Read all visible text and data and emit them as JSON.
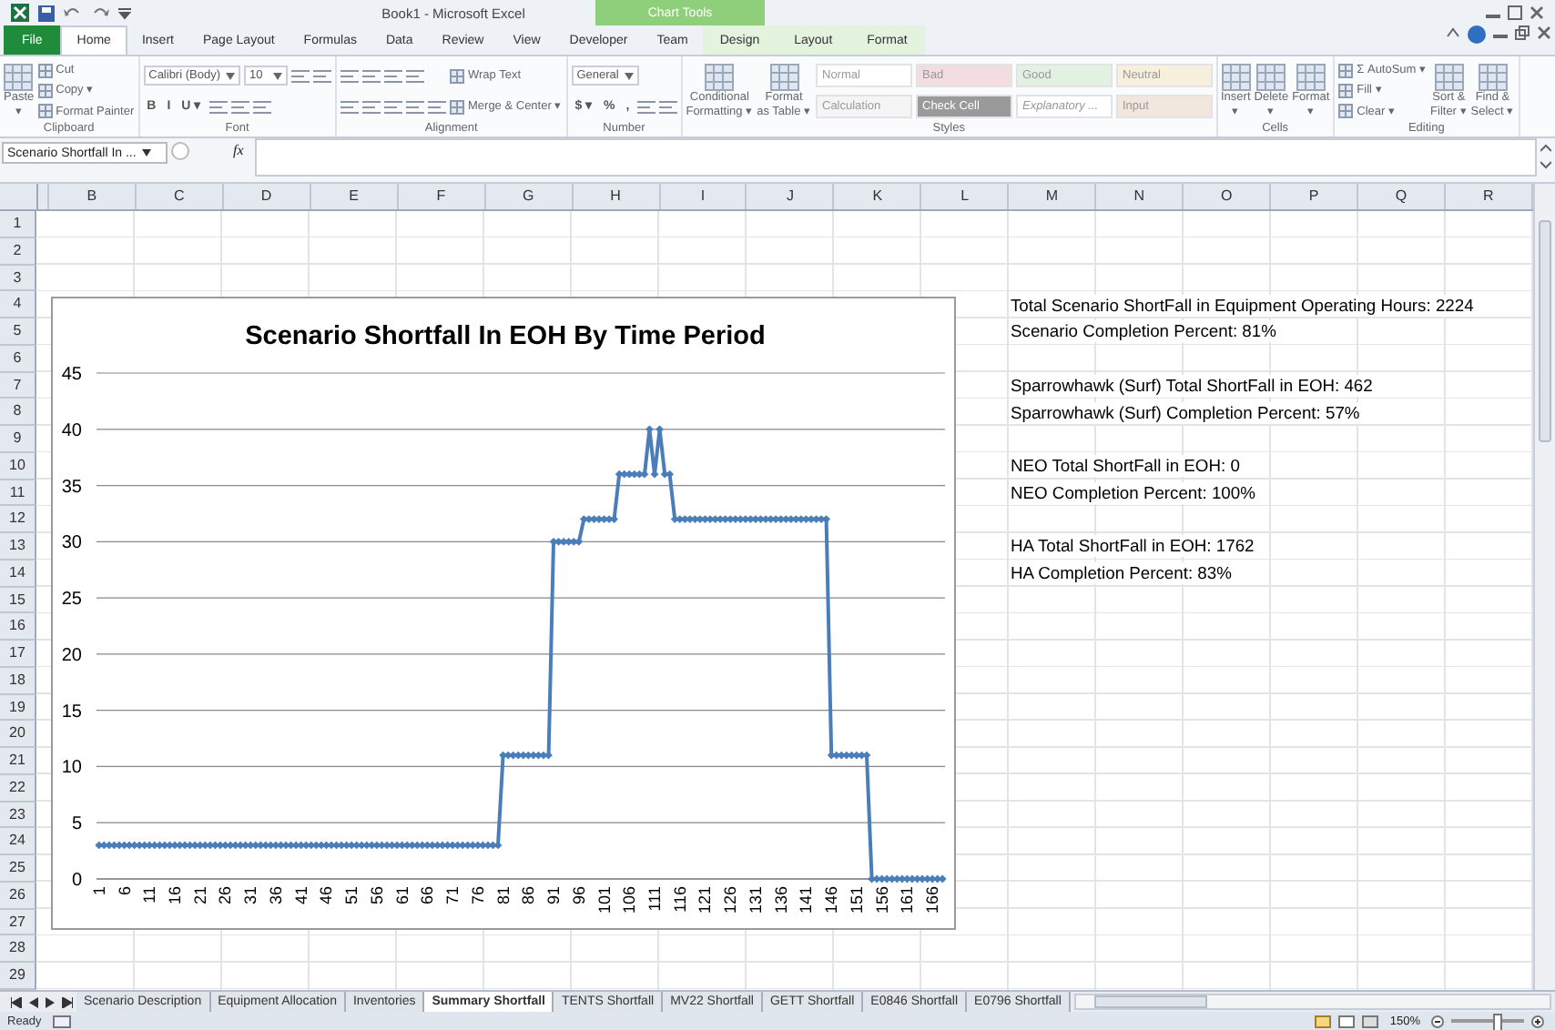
{
  "title_bar": {
    "title": "Book1 - Microsoft Excel",
    "context_group": "Chart Tools"
  },
  "tabs": [
    {
      "label": "File",
      "kind": "file",
      "selected": false
    },
    {
      "label": "Home",
      "kind": "main",
      "selected": true
    },
    {
      "label": "Insert",
      "kind": "main",
      "selected": false
    },
    {
      "label": "Page Layout",
      "kind": "main",
      "selected": false
    },
    {
      "label": "Formulas",
      "kind": "main",
      "selected": false
    },
    {
      "label": "Data",
      "kind": "main",
      "selected": false
    },
    {
      "label": "Review",
      "kind": "main",
      "selected": false
    },
    {
      "label": "View",
      "kind": "main",
      "selected": false
    },
    {
      "label": "Developer",
      "kind": "main",
      "selected": false
    },
    {
      "label": "Team",
      "kind": "main",
      "selected": false
    },
    {
      "label": "Design",
      "kind": "context",
      "selected": false
    },
    {
      "label": "Layout",
      "kind": "context",
      "selected": false
    },
    {
      "label": "Format",
      "kind": "context",
      "selected": false
    }
  ],
  "ribbon": {
    "groups": [
      {
        "label": "Clipboard",
        "columns": [
          [
            [
              {
                "kind": "large",
                "lines": [
                  "Paste",
                  "▾"
                ]
              }
            ]
          ],
          [
            [
              {
                "kind": "small",
                "label": "Cut"
              }
            ],
            [
              {
                "kind": "small",
                "label": "Copy ▾"
              }
            ],
            [
              {
                "kind": "small",
                "label": "Format Painter"
              }
            ]
          ]
        ]
      },
      {
        "label": "Font",
        "columns": [
          [
            [
              {
                "kind": "combo",
                "label": "Calibri (Body)"
              },
              {
                "kind": "combo",
                "label": "10"
              },
              {
                "kind": "icon"
              },
              {
                "kind": "icon"
              }
            ],
            [
              {
                "kind": "text",
                "label": "B"
              },
              {
                "kind": "text",
                "label": "I"
              },
              {
                "kind": "text",
                "label": "U ▾"
              },
              {
                "kind": "icon"
              },
              {
                "kind": "icon"
              },
              {
                "kind": "icon"
              }
            ]
          ]
        ]
      },
      {
        "label": "Alignment",
        "columns": [
          [
            [
              {
                "kind": "icon"
              },
              {
                "kind": "icon"
              },
              {
                "kind": "icon"
              },
              {
                "kind": "icon"
              }
            ],
            [
              {
                "kind": "icon"
              },
              {
                "kind": "icon"
              },
              {
                "kind": "icon"
              },
              {
                "kind": "icon"
              },
              {
                "kind": "icon"
              }
            ]
          ],
          [
            [
              {
                "kind": "small",
                "label": "Wrap Text"
              }
            ],
            [
              {
                "kind": "small",
                "label": "Merge & Center ▾"
              }
            ]
          ]
        ]
      },
      {
        "label": "Number",
        "columns": [
          [
            [
              {
                "kind": "combo",
                "label": "General"
              }
            ],
            [
              {
                "kind": "text",
                "label": "$ ▾"
              },
              {
                "kind": "text",
                "label": "%"
              },
              {
                "kind": "text",
                "label": ","
              },
              {
                "kind": "icon"
              },
              {
                "kind": "icon"
              }
            ]
          ]
        ]
      },
      {
        "label": "Styles",
        "columns": [
          [
            [
              {
                "kind": "large",
                "lines": [
                  "Conditional",
                  "Formatting ▾"
                ]
              }
            ]
          ],
          [
            [
              {
                "kind": "large",
                "lines": [
                  "Format",
                  "as Table ▾"
                ]
              }
            ]
          ],
          [
            [
              {
                "kind": "style",
                "label": "Normal",
                "color": "#ffffff",
                "italic": false
              },
              {
                "kind": "style",
                "label": "Bad",
                "color": "#f4dde0",
                "italic": false
              },
              {
                "kind": "style",
                "label": "Good",
                "color": "#e3f1e3",
                "italic": false
              },
              {
                "kind": "style",
                "label": "Neutral",
                "color": "#f7f0dc",
                "italic": false
              }
            ],
            [
              {
                "kind": "style",
                "label": "Calculation",
                "color": "#f5f5f5",
                "italic": false
              },
              {
                "kind": "style",
                "label": "Check Cell",
                "color": "#9a9a9a",
                "italic": false
              },
              {
                "kind": "style",
                "label": "Explanatory ...",
                "color": "#ffffff",
                "italic": true
              },
              {
                "kind": "style",
                "label": "Input",
                "color": "#f3e6dc",
                "italic": false
              }
            ]
          ]
        ]
      },
      {
        "label": "Cells",
        "columns": [
          [
            [
              {
                "kind": "large",
                "lines": [
                  "Insert",
                  "▾"
                ]
              }
            ]
          ],
          [
            [
              {
                "kind": "large",
                "lines": [
                  "Delete",
                  "▾"
                ]
              }
            ]
          ],
          [
            [
              {
                "kind": "large",
                "lines": [
                  "Format",
                  "▾"
                ]
              }
            ]
          ]
        ]
      },
      {
        "label": "Editing",
        "columns": [
          [
            [
              {
                "kind": "small",
                "label": "Σ AutoSum ▾"
              }
            ],
            [
              {
                "kind": "small",
                "label": "Fill ▾"
              }
            ],
            [
              {
                "kind": "small",
                "label": "Clear ▾"
              }
            ]
          ],
          [
            [
              {
                "kind": "large",
                "lines": [
                  "Sort &",
                  "Filter ▾"
                ]
              }
            ]
          ],
          [
            [
              {
                "kind": "large",
                "lines": [
                  "Find &",
                  "Select ▾"
                ]
              }
            ]
          ]
        ]
      }
    ]
  },
  "formula_bar": {
    "name_box": "Scenario Shortfall In ...",
    "function_label": "fx"
  },
  "sheet": {
    "columns": [
      "B",
      "C",
      "D",
      "E",
      "F",
      "G",
      "H",
      "I",
      "J",
      "K",
      "L",
      "M",
      "N",
      "O",
      "P",
      "Q",
      "R"
    ],
    "rows": [
      {
        "header": "1"
      },
      {
        "header": "2"
      },
      {
        "header": "3"
      },
      {
        "header": "4",
        "text": "Total Scenario ShortFall in Equipment Operating Hours: 2224"
      },
      {
        "header": "5",
        "text": "Scenario Completion Percent: 81%"
      },
      {
        "header": "6"
      },
      {
        "header": "7",
        "text": "Sparrowhawk (Surf) Total ShortFall in EOH: 462"
      },
      {
        "header": "8",
        "text": "Sparrowhawk (Surf) Completion Percent: 57%"
      },
      {
        "header": "9"
      },
      {
        "header": "10",
        "text": "NEO Total ShortFall in EOH: 0"
      },
      {
        "header": "11",
        "text": "NEO Completion Percent: 100%"
      },
      {
        "header": "12"
      },
      {
        "header": "13",
        "text": "HA Total ShortFall in EOH: 1762"
      },
      {
        "header": "14",
        "text": "HA Completion Percent: 83%"
      },
      {
        "header": "15"
      },
      {
        "header": "16"
      },
      {
        "header": "17"
      },
      {
        "header": "18"
      },
      {
        "header": "19"
      },
      {
        "header": "20"
      },
      {
        "header": "21"
      },
      {
        "header": "22"
      },
      {
        "header": "23"
      },
      {
        "header": "24"
      },
      {
        "header": "25"
      },
      {
        "header": "26"
      },
      {
        "header": "27"
      },
      {
        "header": "28"
      },
      {
        "header": "29"
      }
    ]
  },
  "chart": {
    "chart_data": {
      "type": "line",
      "title": "Scenario Shortfall In EOH By Time Period",
      "ylim": [
        0,
        45
      ],
      "grid": true,
      "x": [
        1,
        2,
        3,
        4,
        5,
        6,
        7,
        8,
        9,
        10,
        11,
        12,
        13,
        14,
        15,
        16,
        17,
        18,
        19,
        20,
        21,
        22,
        23,
        24,
        25,
        26,
        27,
        28,
        29,
        30,
        31,
        32,
        33,
        34,
        35,
        36,
        37,
        38,
        39,
        40,
        41,
        42,
        43,
        44,
        45,
        46,
        47,
        48,
        49,
        50,
        51,
        52,
        53,
        54,
        55,
        56,
        57,
        58,
        59,
        60,
        61,
        62,
        63,
        64,
        65,
        66,
        67,
        68,
        69,
        70,
        71,
        72,
        73,
        74,
        75,
        76,
        77,
        78,
        79,
        80,
        81,
        82,
        83,
        84,
        85,
        86,
        87,
        88,
        89,
        90,
        91,
        92,
        93,
        94,
        95,
        96,
        97,
        98,
        99,
        100,
        101,
        102,
        103,
        104,
        105,
        106,
        107,
        108,
        109,
        110,
        111,
        112,
        113,
        114,
        115,
        116,
        117,
        118,
        119,
        120,
        121,
        122,
        123,
        124,
        125,
        126,
        127,
        128,
        129,
        130,
        131,
        132,
        133,
        134,
        135,
        136,
        137,
        138,
        139,
        140,
        141,
        142,
        143,
        144,
        145,
        146,
        147,
        148,
        149,
        150,
        151,
        152,
        153,
        154,
        155,
        156,
        157,
        158,
        159,
        160,
        161,
        162,
        163,
        164,
        165,
        166,
        167,
        168
      ],
      "xlim": [
        1,
        168
      ],
      "xticks": [
        1,
        6,
        11,
        16,
        21,
        26,
        31,
        36,
        41,
        46,
        51,
        56,
        61,
        66,
        71,
        76,
        81,
        86,
        91,
        96,
        101,
        106,
        111,
        116,
        121,
        126,
        131,
        136,
        141,
        146,
        151,
        156,
        161,
        166
      ],
      "yticks": [
        0,
        5,
        10,
        15,
        20,
        25,
        30,
        35,
        40,
        45
      ],
      "series": [
        {
          "color": "#4a7ebb",
          "marker": "diamond",
          "values": [
            3,
            3,
            3,
            3,
            3,
            3,
            3,
            3,
            3,
            3,
            3,
            3,
            3,
            3,
            3,
            3,
            3,
            3,
            3,
            3,
            3,
            3,
            3,
            3,
            3,
            3,
            3,
            3,
            3,
            3,
            3,
            3,
            3,
            3,
            3,
            3,
            3,
            3,
            3,
            3,
            3,
            3,
            3,
            3,
            3,
            3,
            3,
            3,
            3,
            3,
            3,
            3,
            3,
            3,
            3,
            3,
            3,
            3,
            3,
            3,
            3,
            3,
            3,
            3,
            3,
            3,
            3,
            3,
            3,
            3,
            3,
            3,
            3,
            3,
            3,
            3,
            3,
            3,
            3,
            3,
            11,
            11,
            11,
            11,
            11,
            11,
            11,
            11,
            11,
            11,
            30,
            30,
            30,
            30,
            30,
            30,
            32,
            32,
            32,
            32,
            32,
            32,
            32,
            36,
            36,
            36,
            36,
            36,
            36,
            40,
            36,
            40,
            36,
            36,
            32,
            32,
            32,
            32,
            32,
            32,
            32,
            32,
            32,
            32,
            32,
            32,
            32,
            32,
            32,
            32,
            32,
            32,
            32,
            32,
            32,
            32,
            32,
            32,
            32,
            32,
            32,
            32,
            32,
            32,
            32,
            11,
            11,
            11,
            11,
            11,
            11,
            11,
            11,
            0,
            0,
            0,
            0,
            0,
            0,
            0,
            0,
            0,
            0,
            0,
            0,
            0,
            0,
            0
          ]
        }
      ]
    }
  },
  "sheet_tabs": [
    {
      "label": "Scenario Description",
      "selected": false
    },
    {
      "label": "Equipment Allocation",
      "selected": false
    },
    {
      "label": "Inventories",
      "selected": false
    },
    {
      "label": "Summary Shortfall",
      "selected": true
    },
    {
      "label": "TENTS Shortfall",
      "selected": false
    },
    {
      "label": "MV22 Shortfall",
      "selected": false
    },
    {
      "label": "GETT Shortfall",
      "selected": false
    },
    {
      "label": "E0846 Shortfall",
      "selected": false
    },
    {
      "label": "E0796 Shortfall",
      "selected": false
    }
  ],
  "status_bar": {
    "status": "Ready",
    "zoom": "150%",
    "zoom_slider": {
      "level": 0.62
    }
  }
}
